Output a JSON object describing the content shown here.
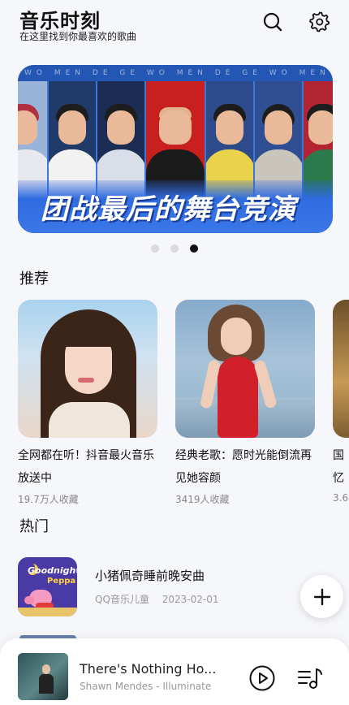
{
  "header": {
    "title": "音乐时刻",
    "subtitle": "在这里找到你最喜欢的歌曲",
    "search_icon": "search-icon",
    "settings_icon": "gear-icon"
  },
  "banner": {
    "strip_text": "WO MEN DE GE WO MEN DE GE WO MEN DE GE",
    "caption": "团战最后的舞台竞演",
    "dots": {
      "count": 3,
      "active_index": 2
    }
  },
  "recommend": {
    "title": "推荐",
    "cards": [
      {
        "text": "全网都在听！抖音最火音乐放送中",
        "meta": "19.7万人收藏"
      },
      {
        "text": "经典老歌：愿时光能倒流再见她容颜",
        "meta": "3419人收藏"
      },
      {
        "text": "国忆",
        "meta": "3.6"
      }
    ]
  },
  "hot": {
    "title": "热门",
    "songs": [
      {
        "title": "小猪佩奇睡前晚安曲",
        "source": "QQ音乐儿童",
        "date": "2023-02-01",
        "cover_text_1": "Goodnight",
        "cover_text_2": "Peppa"
      }
    ]
  },
  "fab": {
    "icon": "plus-icon"
  },
  "player": {
    "title": "There's Nothing Ho...",
    "artist": "Shawn Mendes - Illuminate",
    "play_icon": "play-icon",
    "playlist_icon": "playlist-icon"
  },
  "colors": {
    "background": "#f6f7fb",
    "banner_blue": "#3a77e6",
    "dot_active": "#111111",
    "dot_inactive": "#d9d9de"
  }
}
